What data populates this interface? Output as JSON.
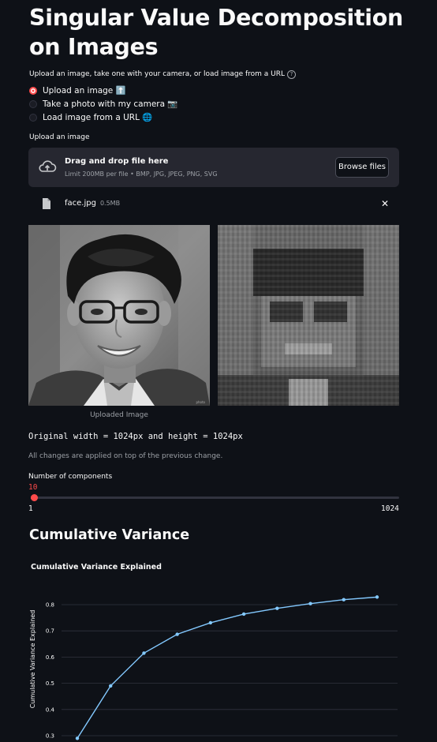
{
  "page": {
    "title": "Singular Value Decomposition on Images",
    "source_label": "Upload an image, take one with your camera, or load image from a URL",
    "help_icon": "?"
  },
  "source_options": [
    {
      "label": "Upload an image ⬆️",
      "selected": true
    },
    {
      "label": "Take a photo with my camera 📷",
      "selected": false
    },
    {
      "label": "Load image from a URL 🌐",
      "selected": false
    }
  ],
  "uploader": {
    "label": "Upload an image",
    "drop_text": "Drag and drop file here",
    "limit_text": "Limit 200MB per file • BMP, JPG, JPEG, PNG, SVG",
    "browse_label": "Browse files",
    "icon": "cloud-upload-icon"
  },
  "file": {
    "name": "face.jpg",
    "size": "0.5MB",
    "icon": "file-icon",
    "remove": "✕"
  },
  "images": {
    "original_caption": "Uploaded Image"
  },
  "info": {
    "dimensions_text": "Original width = 1024px and height = 1024px",
    "note": "All changes are applied on top of the previous change."
  },
  "slider": {
    "label": "Number of components",
    "value": 10,
    "value_text": "10",
    "min": 1,
    "max": 1024,
    "min_text": "1",
    "max_text": "1024",
    "color": "#ff4b4b"
  },
  "section": {
    "heading": "Cumulative Variance"
  },
  "chart_data": {
    "type": "line",
    "title": "Cumulative Variance Explained",
    "xlabel": "",
    "ylabel": "Cumulative Variance Explained",
    "x": [
      1,
      2,
      3,
      4,
      5,
      6,
      7,
      8,
      9,
      10
    ],
    "values": [
      0.29,
      0.49,
      0.615,
      0.687,
      0.731,
      0.764,
      0.786,
      0.804,
      0.819,
      0.829
    ],
    "yticks": [
      "0.3",
      "0.4",
      "0.5",
      "0.6",
      "0.7",
      "0.8"
    ],
    "ylim": [
      0.28,
      0.85
    ],
    "grid": true,
    "line_color": "#83c9ff"
  }
}
